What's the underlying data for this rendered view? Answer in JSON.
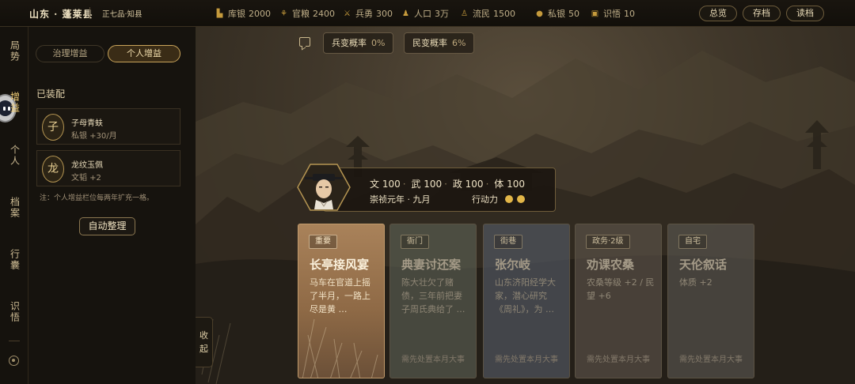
{
  "topbar": {
    "place": "山东 · 蓬莱县",
    "rank": "正七品·知县",
    "resources": [
      {
        "icon": "treasury-icon",
        "label": "库银",
        "value": "2000"
      },
      {
        "icon": "grain-icon",
        "label": "官粮",
        "value": "2400"
      },
      {
        "icon": "soldier-icon",
        "label": "兵勇",
        "value": "300"
      },
      {
        "icon": "population-icon",
        "label": "人口",
        "value": "3万"
      },
      {
        "icon": "refugee-icon",
        "label": "流民",
        "value": "1500"
      },
      {
        "icon": "private-silver-icon",
        "label": "私银",
        "value": "50"
      },
      {
        "icon": "insight-icon",
        "label": "识悟",
        "value": "10"
      }
    ],
    "buttons": {
      "overview": "总览",
      "save": "存档",
      "load": "读档"
    }
  },
  "rail": {
    "tabs": [
      "局势",
      "增益",
      "个人",
      "档案",
      "行囊",
      "识悟"
    ],
    "active": "增益"
  },
  "panel": {
    "segments": {
      "governance": "治理增益",
      "personal": "个人增益"
    },
    "equipped_title": "已装配",
    "slots": [
      {
        "badge": "子",
        "name": "子母青蚨",
        "effect": "私银 +30/月"
      },
      {
        "badge": "龙",
        "name": "龙纹玉佩",
        "effect": "文韬 +2"
      }
    ],
    "note": "注：个人增益栏位每两年扩充一格。",
    "auto_sort": "自动整理",
    "collapse": [
      "收",
      "起"
    ]
  },
  "scene": {
    "mutiny": {
      "label": "兵变概率",
      "value": "0%"
    },
    "revolt": {
      "label": "民变概率",
      "value": "6%"
    },
    "character": {
      "attrs": [
        {
          "name": "文",
          "value": "100"
        },
        {
          "name": "武",
          "value": "100"
        },
        {
          "name": "政",
          "value": "100"
        },
        {
          "name": "体",
          "value": "100"
        }
      ],
      "date": "崇祯元年 · 九月",
      "action_label": "行动力",
      "action_points": 2
    },
    "cards": [
      {
        "tag": "重要",
        "title": "长亭接风宴",
        "desc": "马车在官道上摇了半月，一路上尽是黄 …",
        "foot": ""
      },
      {
        "tag": "衙门",
        "title": "典妻讨还案",
        "desc": "陈大壮欠了赌债，三年前把妻子周氏典给了 …",
        "foot": "需先处置本月大事"
      },
      {
        "tag": "街巷",
        "title": "张尔岐",
        "desc": "山东济阳经学大家，潜心研究《周礼》，为 …",
        "foot": "需先处置本月大事"
      },
      {
        "tag": "政务·2级",
        "title": "劝课农桑",
        "desc": "农桑等级 +2 / 民望 +6",
        "foot": "需先处置本月大事"
      },
      {
        "tag": "自宅",
        "title": "天伦叙话",
        "desc": "体质 +2",
        "foot": "需先处置本月大事"
      }
    ]
  },
  "colors": {
    "accent": "#c9a45a",
    "coin": "#e2b648",
    "highlight_card": "#a9825a"
  }
}
